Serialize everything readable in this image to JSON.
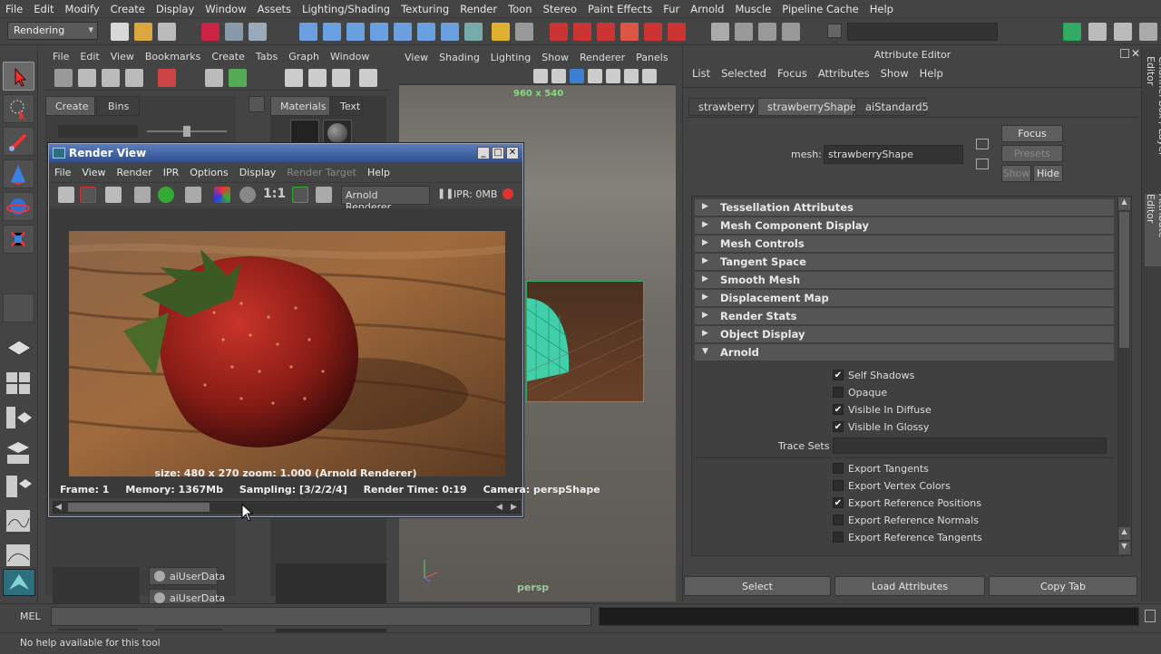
{
  "menubar": [
    "File",
    "Edit",
    "Modify",
    "Create",
    "Display",
    "Window",
    "Assets",
    "Lighting/Shading",
    "Texturing",
    "Render",
    "Toon",
    "Stereo",
    "Paint Effects",
    "Fur",
    "Arnold",
    "Muscle",
    "Pipeline Cache",
    "Help"
  ],
  "mode_menu": "Rendering",
  "outliner": {
    "menu": [
      "File",
      "Edit",
      "View",
      "Bookmarks",
      "Create",
      "Tabs",
      "Graph",
      "Window"
    ],
    "tabs": {
      "create": "Create",
      "bins": "Bins",
      "materials": "Materials",
      "text": "Text"
    },
    "items": [
      "aiUserData",
      "aiUserData"
    ]
  },
  "viewport": {
    "menu": [
      "View",
      "Shading",
      "Lighting",
      "Show",
      "Renderer",
      "Panels"
    ],
    "resolution": "960 x 540",
    "camera_label": "persp"
  },
  "render_view": {
    "title": "Render View",
    "menu": [
      "File",
      "View",
      "Render",
      "IPR",
      "Options",
      "Display",
      "Render Target",
      "Help"
    ],
    "renderer_dropdown": "Arnold Renderer",
    "ipr_label": "IPR: 0MB",
    "ratio_label": "1:1",
    "info": "size: 480 x 270 zoom: 1.000     (Arnold Renderer)",
    "status": {
      "frame": "Frame: 1",
      "memory": "Memory: 1367Mb",
      "sampling": "Sampling: [3/2/2/4]",
      "render_time": "Render Time: 0:19",
      "camera": "Camera: perspShape"
    }
  },
  "attribute_editor": {
    "title": "Attribute Editor",
    "menu": [
      "List",
      "Selected",
      "Focus",
      "Attributes",
      "Show",
      "Help"
    ],
    "tabs": [
      "strawberry",
      "strawberryShape",
      "aiStandard5"
    ],
    "mesh_label": "mesh:",
    "mesh_value": "strawberryShape",
    "focus_button": "Focus",
    "presets_button": "Presets",
    "show_button": "Show",
    "hide_button": "Hide",
    "sections": [
      "Tessellation Attributes",
      "Mesh Component Display",
      "Mesh Controls",
      "Tangent Space",
      "Smooth Mesh",
      "Displacement Map",
      "Render Stats",
      "Object Display",
      "Arnold"
    ],
    "arnold_flags": [
      {
        "label": "Self Shadows",
        "checked": true
      },
      {
        "label": "Opaque",
        "checked": false
      },
      {
        "label": "Visible In Diffuse",
        "checked": true
      },
      {
        "label": "Visible In Glossy",
        "checked": true
      }
    ],
    "trace_sets_label": "Trace Sets",
    "export_flags": [
      {
        "label": "Export Tangents",
        "checked": false
      },
      {
        "label": "Export Vertex Colors",
        "checked": false
      },
      {
        "label": "Export Reference Positions",
        "checked": true
      },
      {
        "label": "Export Reference Normals",
        "checked": false
      },
      {
        "label": "Export Reference Tangents",
        "checked": false
      }
    ],
    "bottom_buttons": {
      "select": "Select",
      "load": "Load Attributes",
      "copy": "Copy Tab"
    }
  },
  "side_tabs": {
    "channel_box": "Channel Box / Layer Editor",
    "attribute_editor": "Attribute Editor"
  },
  "command_line": {
    "label": "MEL"
  },
  "help_line": "No help available for this tool",
  "colors": {
    "accent": "#5b7dbf",
    "checkbox": "#2c2c2c",
    "section": "#555555",
    "wire": "#3fe0b8"
  }
}
